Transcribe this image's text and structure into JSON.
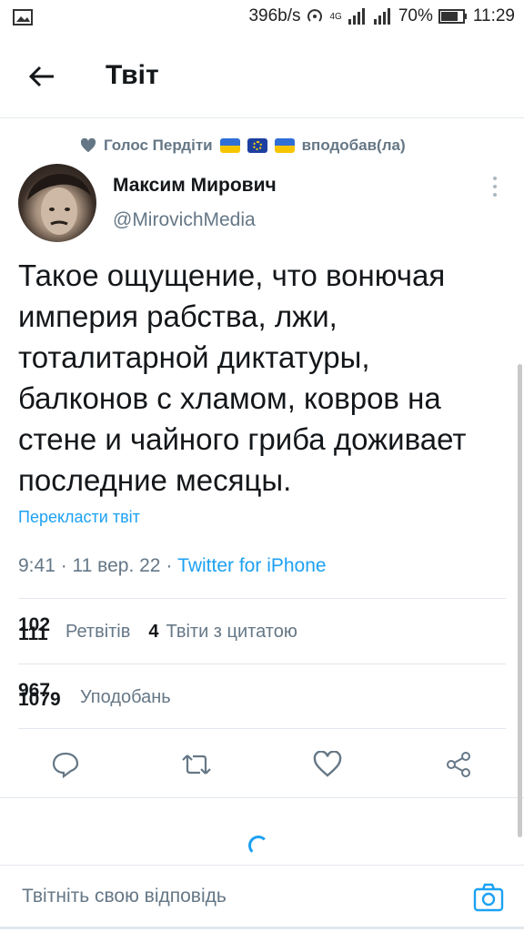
{
  "status_bar": {
    "speed": "396b/s",
    "network": "4G",
    "battery": "70%",
    "time": "11:29"
  },
  "header": {
    "title": "Твіт"
  },
  "liked_by": {
    "name": "Голос Пердіти",
    "action": "вподобав(ла)"
  },
  "author": {
    "name": "Максим Мирович",
    "handle": "@MirovichMedia"
  },
  "tweet": {
    "text_lines": [
      "Такое ощущение, что вонючая",
      "империя рабства, лжи,",
      "тоталитарной диктатуры,",
      "балконов с хламом, ковров на",
      "стене и чайного гриба доживает",
      "последние месяцы."
    ],
    "translate_label": "Перекласти твіт",
    "time": "9:41",
    "date": "11 вер. 22",
    "source": "Twitter for iPhone"
  },
  "stats": {
    "retweets_old": "102",
    "retweets": "111",
    "retweets_label": "Ретвітів",
    "quotes": "4",
    "quotes_label": "Твіти з цитатою",
    "likes_old": "967",
    "likes": "1079",
    "likes_label": "Уподобань"
  },
  "reply": {
    "placeholder": "Твітніть свою відповідь"
  },
  "colors": {
    "accent": "#1da1f2",
    "secondary_text": "#657786",
    "divider": "#e1e8ed"
  }
}
